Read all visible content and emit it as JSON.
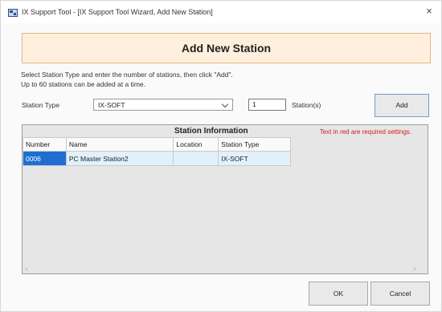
{
  "window": {
    "title": "IX Support Tool - [IX Support Tool Wizard, Add New Station]",
    "close_glyph": "×"
  },
  "header": {
    "title": "Add New Station"
  },
  "instructions": {
    "line1": "Select Station Type and enter the number of stations, then click \"Add\".",
    "line2": "Up to 60 stations can be added at a time."
  },
  "form": {
    "station_type_label": "Station Type",
    "station_type_value": "IX-SOFT",
    "count_value": "1",
    "count_suffix": "Station(s)",
    "add_label": "Add"
  },
  "station_info": {
    "title": "Station Information",
    "required_note": "Text in red are required settings.",
    "columns": [
      "Number",
      "Name",
      "Location",
      "Station Type"
    ],
    "rows": [
      {
        "number": "0006",
        "name": "PC Master Station2",
        "location": "",
        "station_type": "IX-SOFT"
      }
    ]
  },
  "footer": {
    "ok_label": "OK",
    "cancel_label": "Cancel"
  },
  "colors": {
    "header_bg": "#fff0dd",
    "header_border": "#e7b37b",
    "required_text": "#d21c1c",
    "selected_cell": "#1f6fd1",
    "row_bg": "#e1f1fb"
  },
  "icons": {
    "app": "app-icon",
    "close": "close-icon",
    "dropdown": "chevron-down-icon",
    "scroll_left": "scroll-left-icon",
    "scroll_right": "scroll-right-icon"
  }
}
